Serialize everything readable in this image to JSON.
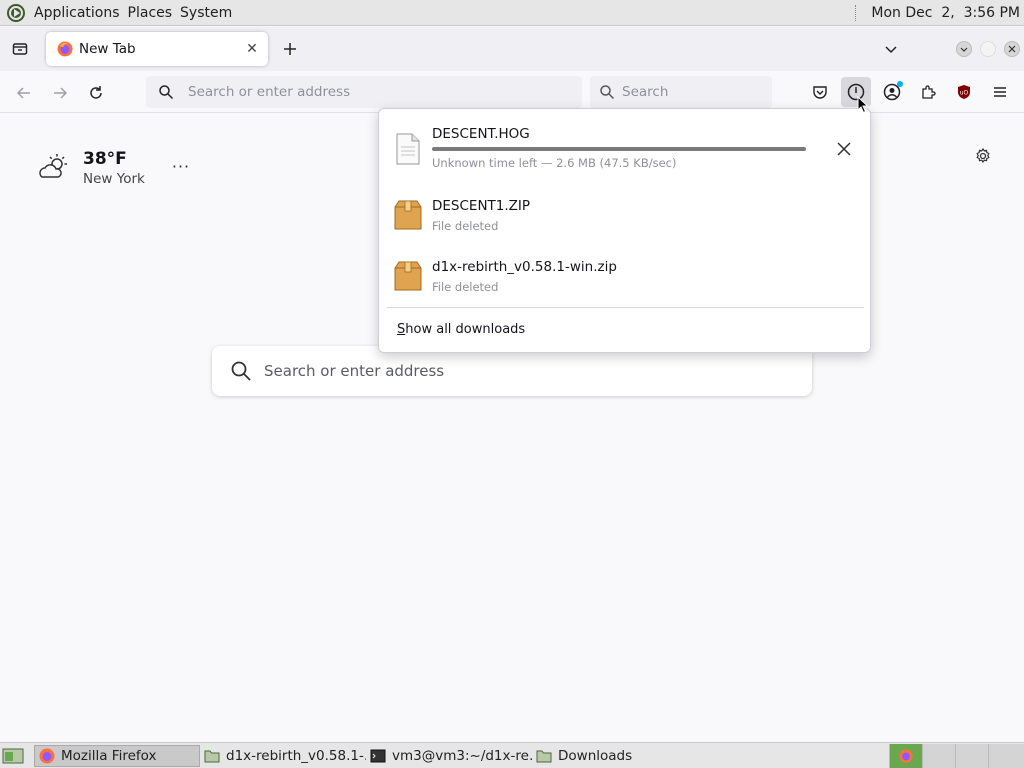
{
  "top_panel": {
    "menus": [
      "Applications",
      "Places",
      "System"
    ],
    "clock": "Mon Dec  2,  3:56 PM"
  },
  "tabs": [
    {
      "title": "New Tab",
      "close_label": "✕"
    }
  ],
  "navbar": {
    "url_placeholder": "Search or enter address",
    "search_placeholder": "Search"
  },
  "weather": {
    "temperature": "38°F",
    "city": "New York",
    "more_label": "···"
  },
  "newtab_search": {
    "placeholder": "Search or enter address"
  },
  "downloads": {
    "items": [
      {
        "name": "DESCENT.HOG",
        "status": "Unknown time left — 2.6 MB (47.5 KB/sec)",
        "progress": 1.0,
        "icon": "generic-file-icon"
      },
      {
        "name": "DESCENT1.ZIP",
        "status": "File deleted",
        "icon": "archive-file-icon"
      },
      {
        "name": "d1x-rebirth_v0.58.1-win.zip",
        "status": "File deleted",
        "icon": "archive-file-icon"
      }
    ],
    "show_all_first": "S",
    "show_all_rest": "how all downloads"
  },
  "taskbar": {
    "tasks": [
      {
        "label": "Mozilla Firefox",
        "icon": "firefox-icon"
      },
      {
        "label": "d1x-rebirth_v0.58.1-…",
        "icon": "folder-icon"
      },
      {
        "label": "vm3@vm3:~/d1x-re…",
        "icon": "terminal-icon"
      },
      {
        "label": "Downloads",
        "icon": "folder-icon"
      }
    ]
  },
  "colors": {
    "accent_blue": "#00b3f4",
    "firefox_orange": "#ff7139",
    "ublock_red": "#800000",
    "workspace_active": "#6aa84f"
  }
}
